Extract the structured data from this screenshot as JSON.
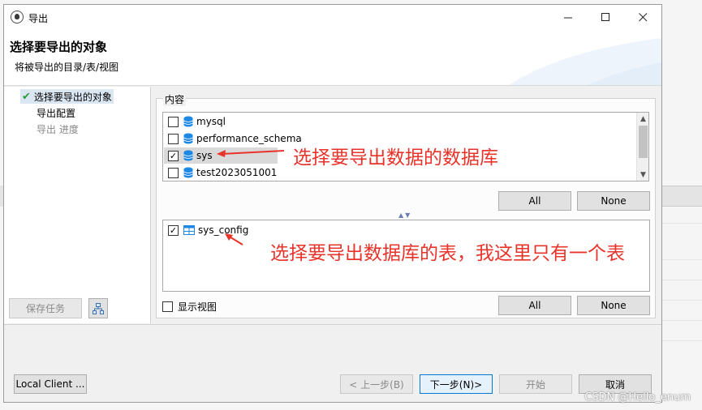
{
  "window": {
    "title": "导出"
  },
  "header": {
    "title": "选择要导出的对象",
    "subtitle": "将被导出的目录/表/视图"
  },
  "steps": [
    {
      "label": "选择要导出的对象",
      "state": "active"
    },
    {
      "label": "导出配置",
      "state": "normal"
    },
    {
      "label": "导出 进度",
      "state": "disabled"
    }
  ],
  "content": {
    "group_label": "内容",
    "databases": [
      {
        "name": "mysql",
        "checked": false
      },
      {
        "name": "performance_schema",
        "checked": false
      },
      {
        "name": "sys",
        "checked": true
      },
      {
        "name": "test2023051001",
        "checked": false
      }
    ],
    "tables": [
      {
        "name": "sys_config",
        "checked": true
      }
    ],
    "all_label": "All",
    "none_label": "None",
    "show_views_label": "显示视图"
  },
  "left_buttons": {
    "save_task": "保存任务"
  },
  "footer": {
    "local_client": "Local Client ...",
    "back": "< 上一步(B)",
    "next": "下一步(N)>",
    "start": "开始",
    "cancel": "取消"
  },
  "annotations": {
    "db_note": "选择要导出数据的数据库",
    "table_note": "选择要导出数据库的表，我这里只有一个表"
  },
  "watermark": "CSDN @Hello_enum",
  "colors": {
    "annotation": "#e8332b",
    "accent": "#0078d7",
    "db_icon": "#1e88e5"
  }
}
